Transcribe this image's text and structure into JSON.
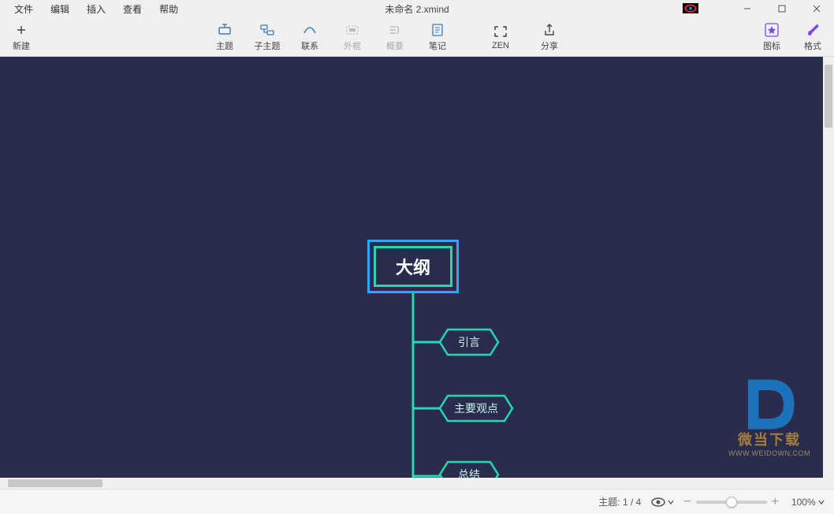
{
  "window": {
    "title": "未命名 2.xmind"
  },
  "menu": {
    "file": "文件",
    "edit": "编辑",
    "insert": "插入",
    "view": "查看",
    "help": "帮助"
  },
  "toolbar": {
    "new": "新建",
    "topic": "主题",
    "subtopic": "子主题",
    "relation": "联系",
    "boundary": "外框",
    "summary": "概要",
    "note": "笔记",
    "zen": "ZEN",
    "share": "分享",
    "icon": "图标",
    "format": "格式"
  },
  "mindmap": {
    "root": "大纲",
    "children": [
      "引言",
      "主要观点",
      "总结"
    ]
  },
  "watermark": {
    "line1": "微当下载",
    "line2": "WWW.WEIDOWN.COM"
  },
  "status": {
    "topic_label": "主题:",
    "topic_index": "1 / 4",
    "zoom_percent": "100%",
    "zoom_value": 100
  }
}
